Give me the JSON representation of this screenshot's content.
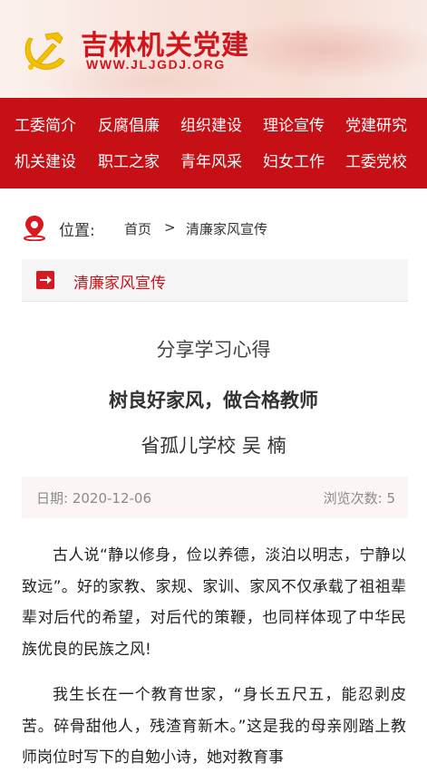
{
  "header": {
    "site_title": "吉林机关党建",
    "site_url": "WWW.JLJGDJ.ORG",
    "logo_icon": "party-emblem-icon",
    "brand_color": "#d2141b"
  },
  "nav": {
    "background": "#c70f16",
    "row1": [
      "工委简介",
      "反腐倡廉",
      "组织建设",
      "理论宣传",
      "党建研究"
    ],
    "row2": [
      "机关建设",
      "职工之家",
      "青年风采",
      "妇女工作",
      "工委党校"
    ]
  },
  "breadcrumb": {
    "icon": "location-pin-icon",
    "label": "位置:",
    "home": "首页",
    "separator": ">",
    "current": "清廉家风宣传"
  },
  "section": {
    "icon": "arrow-right-icon",
    "title": "清廉家风宣传"
  },
  "article": {
    "kicker": "分享学习心得",
    "title": "树良好家风，做合格教师",
    "author": "省孤儿学校 吴 楠",
    "date_label": "日期: ",
    "date": "2020-12-06",
    "views_label": "浏览次数: ",
    "views": "5",
    "paragraphs": [
      "古人说“静以修身，俭以养德，淡泊以明志，宁静以致远”。好的家教、家规、家训、家风不仅承载了祖祖辈辈对后代的希望，对后代的策鞭，也同样体现了中华民族优良的民族之风!",
      "我生长在一个教育世家，“身长五尺五，能忍剥皮苦。碎骨甜他人，残渣育新木。”这是我的母亲刚踏上教师岗位时写下的自勉小诗，她对教育事"
    ]
  }
}
